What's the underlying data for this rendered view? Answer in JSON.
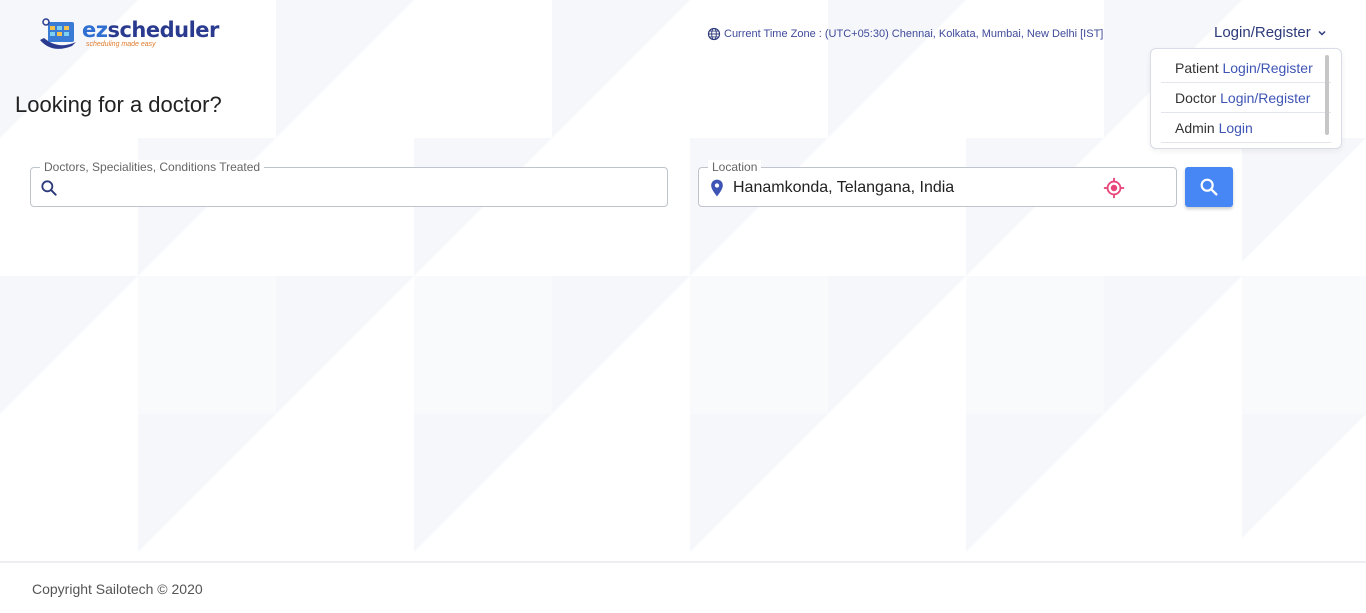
{
  "brand": {
    "name_prefix": "ez",
    "name_suffix": "scheduler",
    "tagline": "scheduling made easy"
  },
  "header": {
    "timezone_text": "Current Time Zone : (UTC+05:30) Chennai, Kolkata, Mumbai, New Delhi [IST]",
    "login_label": "Login/Register"
  },
  "dropdown": {
    "items": [
      {
        "role": "Patient",
        "action": "Login/Register"
      },
      {
        "role": "Doctor",
        "action": "Login/Register"
      },
      {
        "role": "Admin",
        "action": "Login"
      }
    ]
  },
  "main": {
    "title": "Looking for a doctor?",
    "search": {
      "label": "Doctors, Specialities, Conditions Treated",
      "value": ""
    },
    "location": {
      "label": "Location",
      "value": "Hanamkonda, Telangana, India"
    }
  },
  "footer": {
    "copyright": "Copyright Sailotech © 2020"
  },
  "colors": {
    "accent": "#4787f5",
    "link": "#3f55b5",
    "brand_dark": "#2a3b8f",
    "locate_pink": "#e8457a"
  },
  "icons": [
    "globe-icon",
    "chevron-down-icon",
    "search-icon",
    "map-pin-icon",
    "my-location-icon"
  ]
}
